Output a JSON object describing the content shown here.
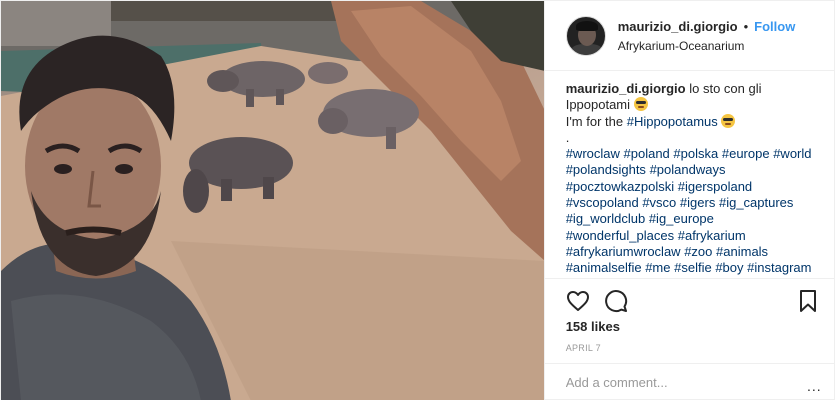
{
  "header": {
    "username": "maurizio_di.giorgio",
    "separator": "•",
    "follow_label": "Follow",
    "location": "Afrykarium-Oceanarium"
  },
  "caption": {
    "username": "maurizio_di.giorgio",
    "line1": "lo sto con gli Ippopotami",
    "line2_prefix": "I'm for the",
    "line2_tag": "#Hippopotamus",
    "spacer": ".",
    "hashtags": [
      "#wroclaw",
      "#poland",
      "#polska",
      "#europe",
      "#world",
      "#polandsights",
      "#polandways",
      "#pocztowkazpolski",
      "#igerspoland",
      "#vscopoland",
      "#vsco",
      "#igers",
      "#ig_captures",
      "#ig_worldclub",
      "#ig_europe",
      "#wonderful_places",
      "#afrykarium",
      "#afrykariumwroclaw",
      "#zoo",
      "#animals",
      "#animalselfie",
      "#me",
      "#selfie",
      "#boy",
      "#instagram"
    ]
  },
  "icons": {
    "like": "heart-icon",
    "comment": "comment-icon",
    "save": "bookmark-icon",
    "emoji": "grinning-face-emoji"
  },
  "likes_text": "158 likes",
  "date_text": "APRIL 7",
  "comment": {
    "placeholder": "Add a comment...",
    "more_label": "..."
  },
  "colors": {
    "link": "#003569",
    "follow": "#3897f0",
    "muted": "#999999",
    "border": "#efefef"
  }
}
